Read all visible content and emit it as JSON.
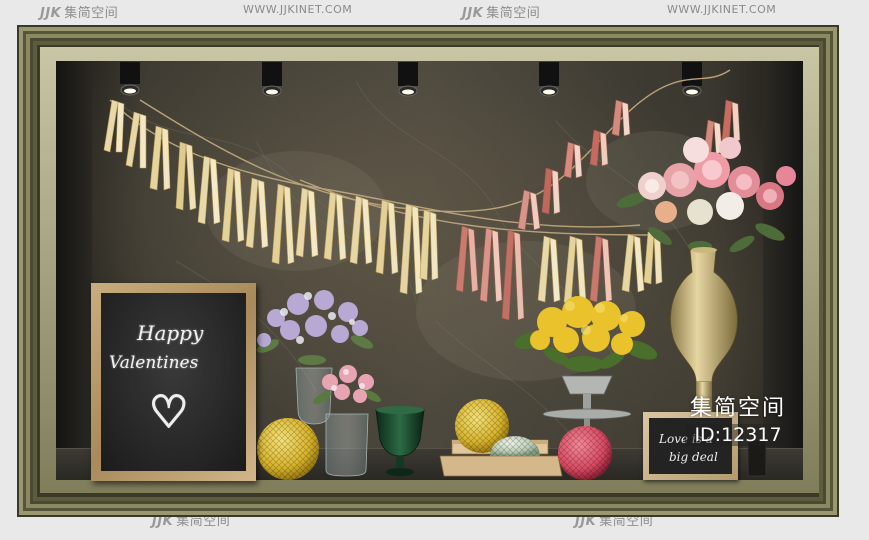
{
  "watermarks": {
    "brand": "集简空间",
    "brand_mark": "JJK",
    "url": "WWW.JJKINET.COM"
  },
  "blackboard": {
    "line1": "Happy",
    "line2": "Valentines",
    "heart": "♡"
  },
  "small_board": {
    "line1": "Love is a",
    "line2": "big deal"
  },
  "id_overlay": {
    "title": "集简空间",
    "code": "ID:12317"
  },
  "colors": {
    "frame": "#6c6a48",
    "niche": "#3b3830",
    "yellow_ball": "#e0c23a",
    "pink_ball": "#e0566e",
    "tassel_cream": "#e8dcb0",
    "tassel_pink": "#d98a86"
  }
}
